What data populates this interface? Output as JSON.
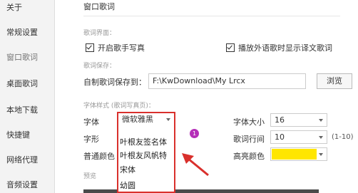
{
  "sidebar": {
    "items": [
      {
        "label": "关于"
      },
      {
        "label": "常规设置"
      },
      {
        "label": "窗口歌词"
      },
      {
        "label": "桌面歌词"
      },
      {
        "label": "本地下载"
      },
      {
        "label": "快捷键"
      },
      {
        "label": "网络代理"
      },
      {
        "label": "音频设置"
      }
    ],
    "active_index": 2
  },
  "main": {
    "section_title": "窗口歌词",
    "lyrics_interface": {
      "header": "歌词界面：",
      "show_singer_photo": {
        "label": "开启歌手写真",
        "checked": true
      },
      "show_translation": {
        "label": "播放外语歌时显示译文歌词",
        "checked": true
      }
    },
    "lyrics_save": {
      "header": "歌词保存：",
      "path_label": "自制歌词保存到：",
      "path_value": "F:\\KwDownload\\My Lrcx",
      "browse_label": "浏览"
    },
    "font_style": {
      "header": "字体样式 (歌词写真页)：",
      "font_label": "字体",
      "font_value": "微软雅黑",
      "glyph_label": "字形",
      "normal_color_label": "普通颜色",
      "font_size_label": "字体大小",
      "font_size_value": "16",
      "line_spacing_label": "歌词行间",
      "line_spacing_value": "10",
      "line_spacing_range": "(1-10)",
      "highlight_color_label": "高亮颜色",
      "highlight_color": "#ffe600"
    },
    "preview_label": "预览"
  },
  "font_dropdown": {
    "options": [
      "叶根友签名体",
      "叶根友风帆特",
      "宋体",
      "幼圆"
    ]
  },
  "annotation": {
    "badge_text": "1",
    "highlight_color": "#d9302c",
    "badge_color": "#b52fb8"
  }
}
